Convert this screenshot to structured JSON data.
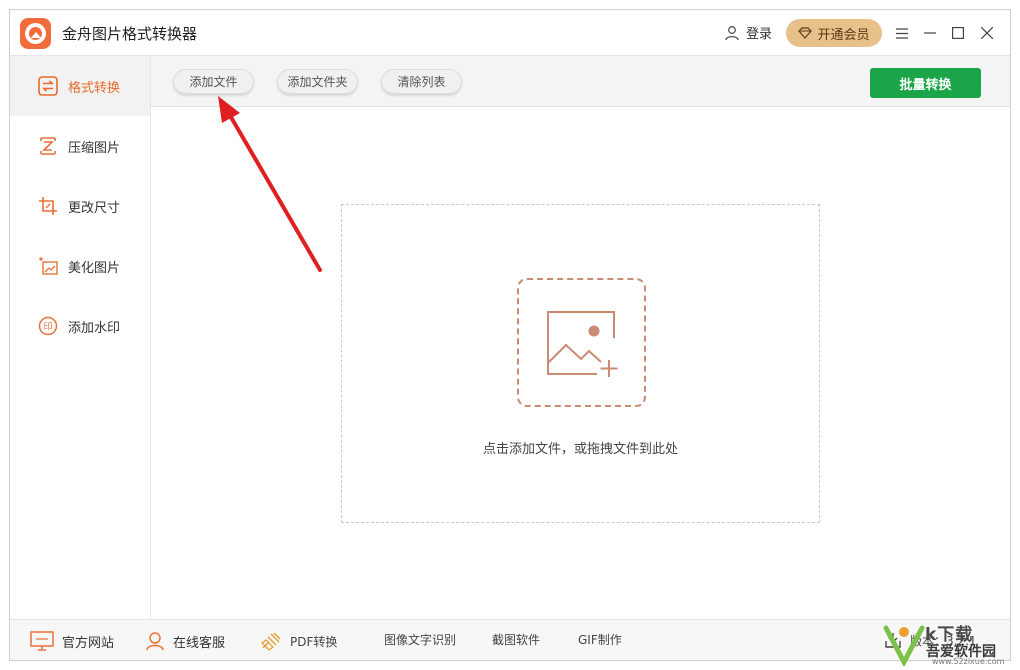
{
  "app": {
    "title": "金舟图片格式转换器"
  },
  "header": {
    "login_label": "登录",
    "vip_label": "开通会员"
  },
  "sidebar": {
    "items": [
      {
        "label": "格式转换",
        "icon": "convert-icon",
        "active": true
      },
      {
        "label": "压缩图片",
        "icon": "compress-icon",
        "active": false
      },
      {
        "label": "更改尺寸",
        "icon": "crop-icon",
        "active": false
      },
      {
        "label": "美化图片",
        "icon": "beautify-icon",
        "active": false
      },
      {
        "label": "添加水印",
        "icon": "watermark-icon",
        "active": false
      }
    ]
  },
  "toolbar": {
    "add_file_label": "添加文件",
    "add_folder_label": "添加文件夹",
    "clear_list_label": "清除列表",
    "batch_convert_label": "批量转换"
  },
  "dropzone": {
    "hint": "点击添加文件，或拖拽文件到此处"
  },
  "footer": {
    "official_site": "官方网站",
    "online_service": "在线客服",
    "pdf_convert": "PDF转换",
    "ocr": "图像文字识别",
    "screenshot": "截图软件",
    "gif": "GIF制作",
    "version_label": "版本：3.2.1"
  },
  "watermark": {
    "line1": "k下载",
    "line2": "吾爱软件园",
    "line3": "www.52zixue.com"
  },
  "colors": {
    "accent": "#e66a2c",
    "brand_green": "#1ba548",
    "vip_gold": "#e7c08a",
    "arrow_red": "#e02020"
  }
}
